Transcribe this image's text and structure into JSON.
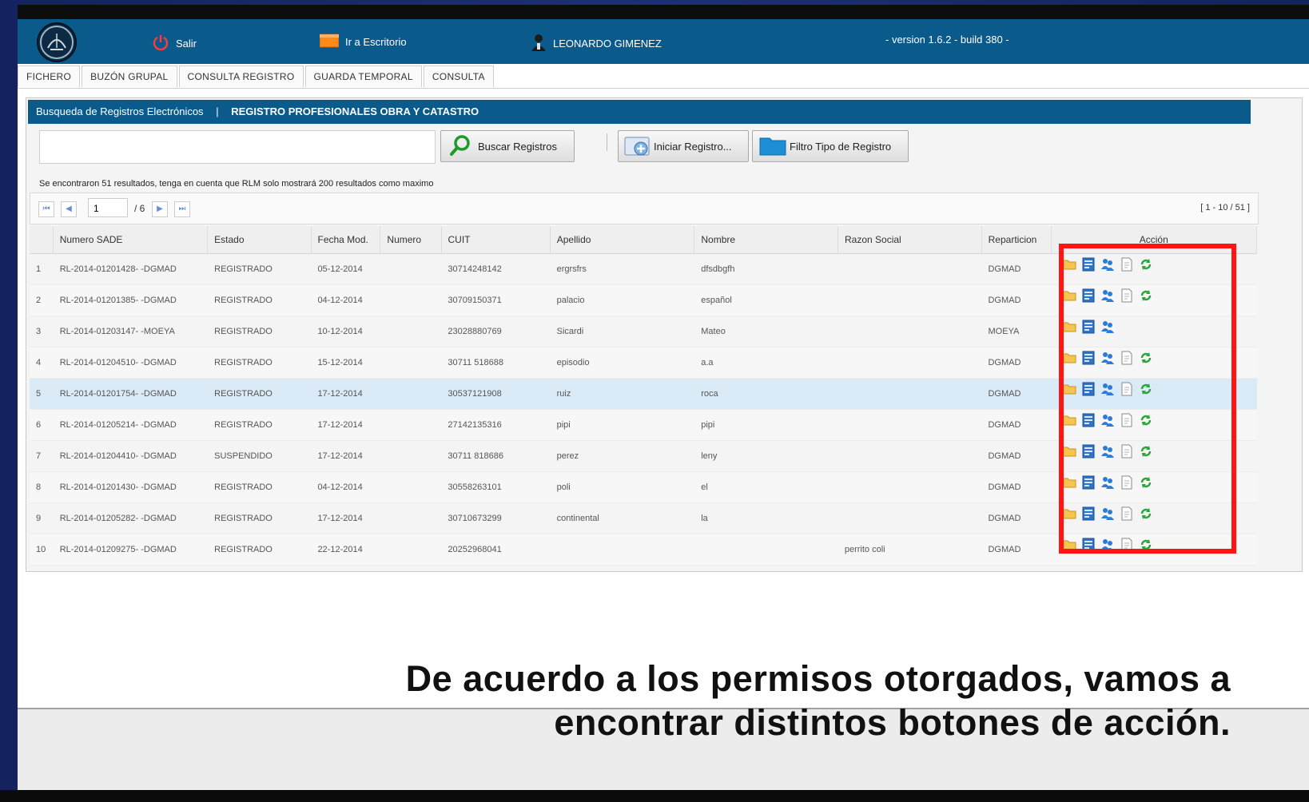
{
  "topbar": {
    "exit_label": "Salir",
    "desktop_label": "Ir a Escritorio",
    "user_name": "LEONARDO GIMENEZ",
    "version": "- version 1.6.2 - build 380 -"
  },
  "tabs": [
    "FICHERO",
    "BUZÓN GRUPAL",
    "CONSULTA REGISTRO",
    "GUARDA TEMPORAL",
    "CONSULTA"
  ],
  "panel": {
    "breadcrumb": "Busqueda de Registros Electrónicos",
    "separator": "|",
    "title": "REGISTRO PROFESIONALES OBRA Y CATASTRO"
  },
  "search": {
    "value": "",
    "placeholder": ""
  },
  "buttons": {
    "search": "Buscar Registros",
    "init": "Iniciar Registro...",
    "filter": "Filtro Tipo de Registro"
  },
  "results_message": "Se encontraron 51 resultados, tenga en cuenta que RLM solo mostrará 200 resultados como maximo",
  "pager": {
    "page": "1",
    "total": "/ 6",
    "range": "[ 1 - 10 / 51 ]"
  },
  "columns": [
    "",
    "Numero SADE",
    "Estado",
    "Fecha Mod.",
    "Numero",
    "CUIT",
    "Apellido",
    "Nombre",
    "Razon Social",
    "Reparticion",
    "Acción"
  ],
  "rows": [
    {
      "n": "1",
      "sade": "RL-2014-01201428- -DGMAD",
      "estado": "REGISTRADO",
      "fecha": "05-12-2014",
      "numero": "",
      "cuit": "30714248142",
      "apellido": "ergrsfrs",
      "nombre": "dfsdbgfh",
      "razon": "",
      "rep": "DGMAD",
      "actions": [
        "folder",
        "form",
        "users",
        "document",
        "refresh"
      ]
    },
    {
      "n": "2",
      "sade": "RL-2014-01201385- -DGMAD",
      "estado": "REGISTRADO",
      "fecha": "04-12-2014",
      "numero": "",
      "cuit": "30709150371",
      "apellido": "palacio",
      "nombre": "español",
      "razon": "",
      "rep": "DGMAD",
      "actions": [
        "folder",
        "form",
        "users",
        "document",
        "refresh"
      ]
    },
    {
      "n": "3",
      "sade": "RL-2014-01203147- -MOEYA",
      "estado": "REGISTRADO",
      "fecha": "10-12-2014",
      "numero": "",
      "cuit": "23028880769",
      "apellido": "Sicardi",
      "nombre": "Mateo",
      "razon": "",
      "rep": "MOEYA",
      "actions": [
        "folder",
        "form",
        "users"
      ]
    },
    {
      "n": "4",
      "sade": "RL-2014-01204510- -DGMAD",
      "estado": "REGISTRADO",
      "fecha": "15-12-2014",
      "numero": "",
      "cuit": "30711 518688",
      "apellido": "episodio",
      "nombre": "a.a",
      "razon": "",
      "rep": "DGMAD",
      "actions": [
        "folder",
        "form",
        "users",
        "document",
        "refresh"
      ]
    },
    {
      "n": "5",
      "sade": "RL-2014-01201754- -DGMAD",
      "estado": "REGISTRADO",
      "fecha": "17-12-2014",
      "numero": "",
      "cuit": "30537121908",
      "apellido": "ruiz",
      "nombre": "roca",
      "razon": "",
      "rep": "DGMAD",
      "actions": [
        "folder",
        "form",
        "users",
        "document",
        "refresh"
      ]
    },
    {
      "n": "6",
      "sade": "RL-2014-01205214- -DGMAD",
      "estado": "REGISTRADO",
      "fecha": "17-12-2014",
      "numero": "",
      "cuit": "27142135316",
      "apellido": "pipi",
      "nombre": "pipi",
      "razon": "",
      "rep": "DGMAD",
      "actions": [
        "folder",
        "form",
        "users",
        "document",
        "refresh"
      ]
    },
    {
      "n": "7",
      "sade": "RL-2014-01204410- -DGMAD",
      "estado": "SUSPENDIDO",
      "fecha": "17-12-2014",
      "numero": "",
      "cuit": "30711 818686",
      "apellido": "perez",
      "nombre": "leny",
      "razon": "",
      "rep": "DGMAD",
      "actions": [
        "folder",
        "form",
        "users",
        "document",
        "refresh"
      ]
    },
    {
      "n": "8",
      "sade": "RL-2014-01201430- -DGMAD",
      "estado": "REGISTRADO",
      "fecha": "04-12-2014",
      "numero": "",
      "cuit": "30558263101",
      "apellido": "poli",
      "nombre": "el",
      "razon": "",
      "rep": "DGMAD",
      "actions": [
        "folder",
        "form",
        "users",
        "document",
        "refresh"
      ]
    },
    {
      "n": "9",
      "sade": "RL-2014-01205282- -DGMAD",
      "estado": "REGISTRADO",
      "fecha": "17-12-2014",
      "numero": "",
      "cuit": "30710673299",
      "apellido": "continental",
      "nombre": "la",
      "razon": "",
      "rep": "DGMAD",
      "actions": [
        "folder",
        "form",
        "users",
        "document",
        "refresh"
      ]
    },
    {
      "n": "10",
      "sade": "RL-2014-01209275- -DGMAD",
      "estado": "REGISTRADO",
      "fecha": "22-12-2014",
      "numero": "",
      "cuit": "20252968041",
      "apellido": "",
      "nombre": "",
      "razon": "perrito coli",
      "rep": "DGMAD",
      "actions": [
        "folder",
        "form",
        "users",
        "document",
        "refresh"
      ]
    }
  ],
  "caption": {
    "line1": "De acuerdo a los permisos otorgados, vamos a",
    "line2": "encontrar distintos botones de acción."
  },
  "colors": {
    "brand": "#0b5a8c",
    "highlight": "#ff1414",
    "selected_row": "#dbeaf7"
  }
}
